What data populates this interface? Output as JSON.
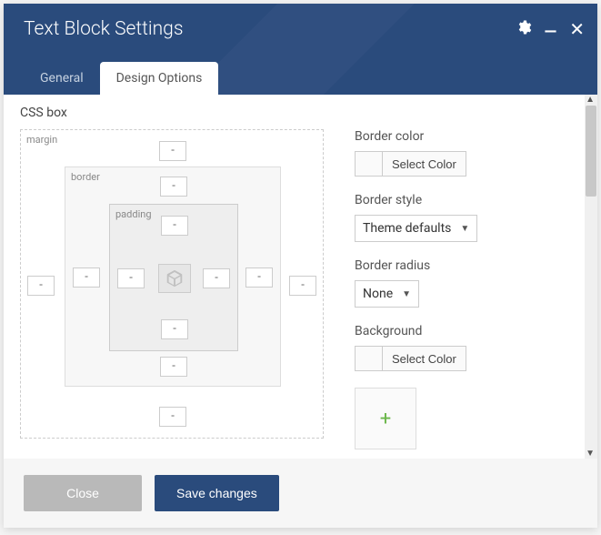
{
  "header": {
    "title": "Text Block Settings"
  },
  "tabs": {
    "general": "General",
    "design": "Design Options"
  },
  "css_box": {
    "heading": "CSS box",
    "labels": {
      "margin": "margin",
      "border": "border",
      "padding": "padding"
    },
    "values": {
      "margin_top": "-",
      "margin_right": "-",
      "margin_bottom": "-",
      "margin_left": "-",
      "border_top": "-",
      "border_right": "-",
      "border_bottom": "-",
      "border_left": "-",
      "padding_top": "-",
      "padding_right": "-",
      "padding_bottom": "-",
      "padding_left": "-"
    }
  },
  "right": {
    "border_color_label": "Border color",
    "select_color_btn": "Select Color",
    "border_style_label": "Border style",
    "border_style_value": "Theme defaults",
    "border_radius_label": "Border radius",
    "border_radius_value": "None",
    "background_label": "Background"
  },
  "footer": {
    "close": "Close",
    "save": "Save changes"
  }
}
